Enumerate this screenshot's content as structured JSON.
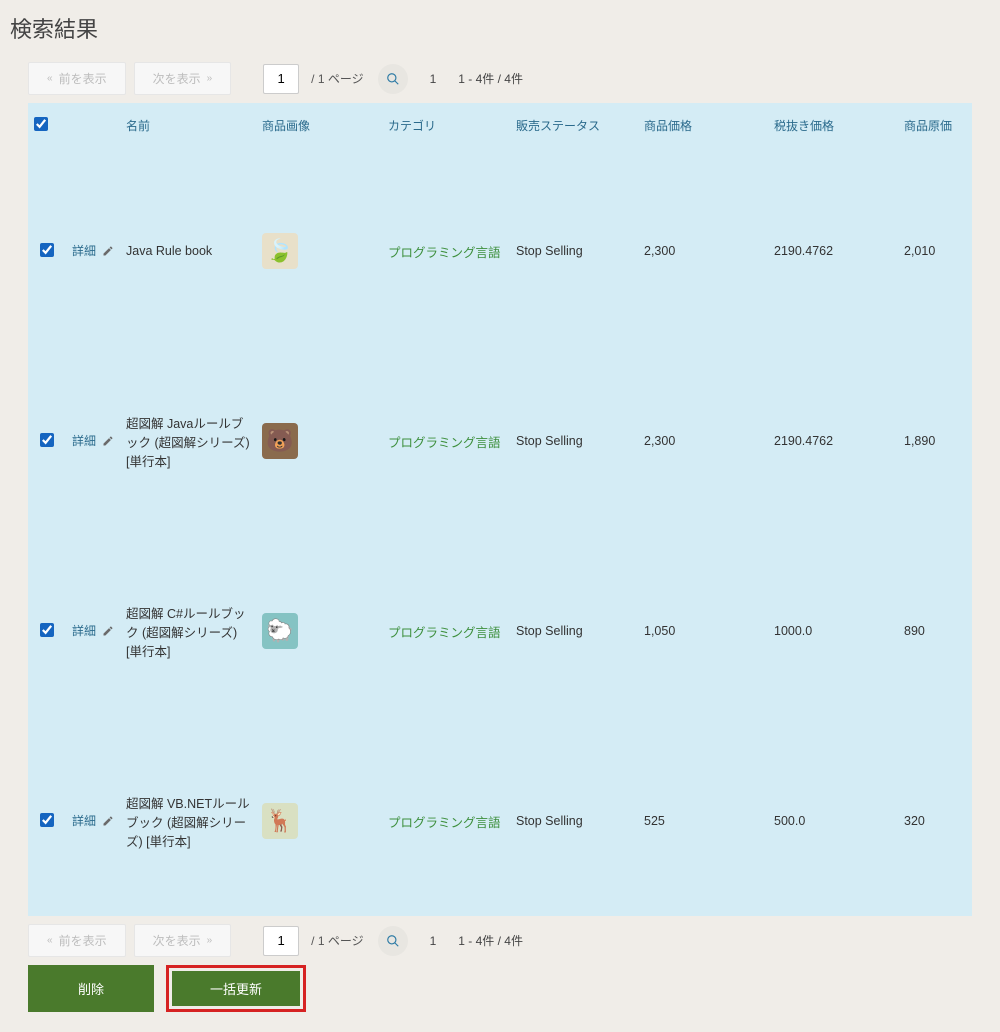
{
  "page_title": "検索結果",
  "pager": {
    "prev_label": "前を表示",
    "next_label": "次を表示",
    "page_input_value": "1",
    "of_text": "/ 1 ページ",
    "count_index": "1",
    "count_range": "1 - 4件 / 4件"
  },
  "columns": {
    "checkbox_header": "",
    "name": "名前",
    "image": "商品画像",
    "category": "カテゴリ",
    "status": "販売ステータス",
    "price": "商品価格",
    "price_notax": "税抜き価格",
    "cost": "商品原価"
  },
  "detail_label": "詳細",
  "rows": [
    {
      "checked": true,
      "name": "Java Rule book",
      "icon": "leaf",
      "category": "プログラミング言語",
      "status": "Stop Selling",
      "price": "2,300",
      "price_notax": "2190.4762",
      "cost": "2,010"
    },
    {
      "checked": true,
      "name": "超図解 Javaルールブック (超図解シリーズ) [単行本]",
      "icon": "bear",
      "category": "プログラミング言語",
      "status": "Stop Selling",
      "price": "2,300",
      "price_notax": "2190.4762",
      "cost": "1,890"
    },
    {
      "checked": true,
      "name": "超図解 C#ルールブック (超図解シリーズ) [単行本]",
      "icon": "sheep",
      "category": "プログラミング言語",
      "status": "Stop Selling",
      "price": "1,050",
      "price_notax": "1000.0",
      "cost": "890"
    },
    {
      "checked": true,
      "name": "超図解 VB.NETルールブック (超図解シリーズ) [単行本]",
      "icon": "deer",
      "category": "プログラミング言語",
      "status": "Stop Selling",
      "price": "525",
      "price_notax": "500.0",
      "cost": "320"
    }
  ],
  "actions": {
    "delete": "削除",
    "bulk_update": "一括更新"
  }
}
